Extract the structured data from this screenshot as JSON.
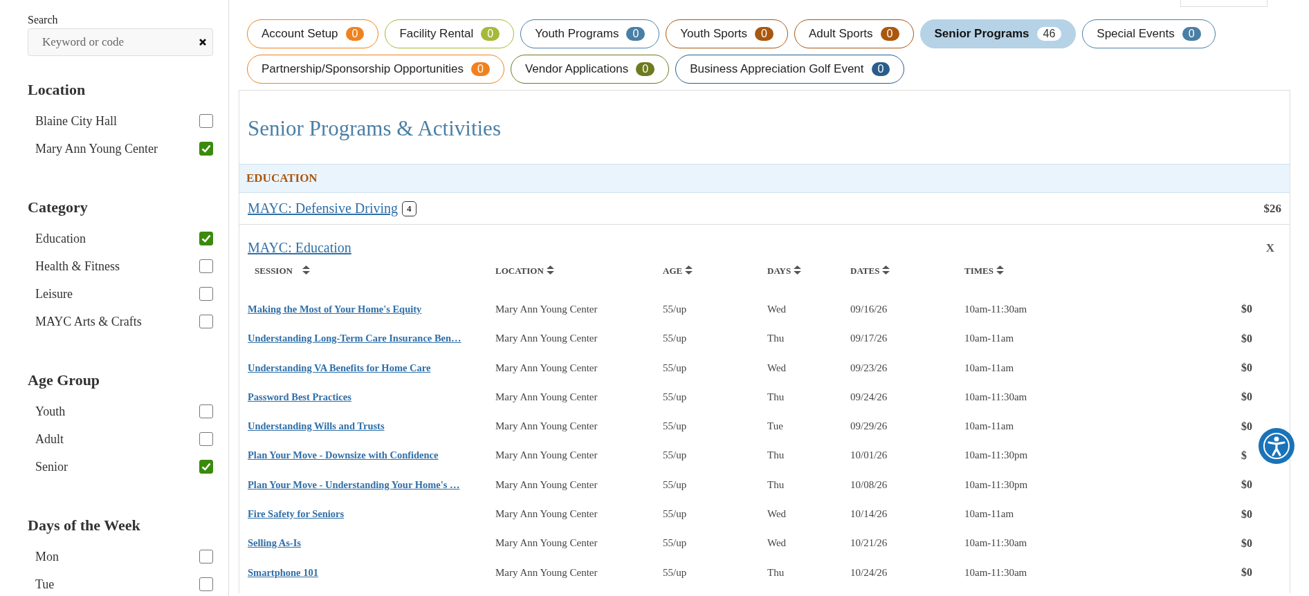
{
  "search": {
    "label": "Search",
    "placeholder": "Keyword or code"
  },
  "filters": [
    {
      "title": "Location",
      "options": [
        {
          "label": "Blaine City Hall",
          "checked": false
        },
        {
          "label": "Mary Ann Young Center",
          "checked": true
        }
      ]
    },
    {
      "title": "Category",
      "options": [
        {
          "label": "Education",
          "checked": true
        },
        {
          "label": "Health & Fitness",
          "checked": false
        },
        {
          "label": "Leisure",
          "checked": false
        },
        {
          "label": "MAYC Arts & Crafts",
          "checked": false
        }
      ]
    },
    {
      "title": "Age Group",
      "options": [
        {
          "label": "Youth",
          "checked": false
        },
        {
          "label": "Adult",
          "checked": false
        },
        {
          "label": "Senior",
          "checked": true
        }
      ]
    },
    {
      "title": "Days of the Week",
      "options": [
        {
          "label": "Mon",
          "checked": false
        },
        {
          "label": "Tue",
          "checked": false
        }
      ]
    }
  ],
  "tabs": [
    {
      "label": "Account Setup",
      "count": "0",
      "color": "#f0821e",
      "selected": false
    },
    {
      "label": "Facility Rental",
      "count": "0",
      "color": "#a6b938",
      "selected": false
    },
    {
      "label": "Youth Programs",
      "count": "0",
      "color": "#4a7fa5",
      "selected": false
    },
    {
      "label": "Youth Sports",
      "count": "0",
      "color": "#a9570f",
      "selected": false
    },
    {
      "label": "Adult Sports",
      "count": "0",
      "color": "#a9570f",
      "selected": false
    },
    {
      "label": "Senior Programs",
      "count": "46",
      "color": "#b6d2e6",
      "selected": true
    },
    {
      "label": "Special Events",
      "count": "0",
      "color": "#4a7fa5",
      "selected": false
    },
    {
      "label": "Partnership/Sponsorship Opportunities",
      "count": "0",
      "color": "#f0821e",
      "selected": false
    },
    {
      "label": "Vendor Applications",
      "count": "0",
      "color": "#6e7a1f",
      "selected": false
    },
    {
      "label": "Business Appreciation Golf Event",
      "count": "0",
      "color": "#2a5d8a",
      "selected": false
    }
  ],
  "panel": {
    "title": "Senior Programs & Activities",
    "sections": [
      {
        "heading": "EDUCATION",
        "programs": [
          {
            "kind": "collapsed",
            "title": "MAYC: Defensive Driving",
            "count": "4",
            "price": "$26"
          },
          {
            "kind": "expanded",
            "title": "MAYC: Education",
            "close": "X",
            "columns": [
              "SESSION",
              "LOCATION",
              "AGE",
              "DAYS",
              "DATES",
              "TIMES"
            ],
            "sessions": [
              {
                "session": "Making the Most of Your Home's Equity",
                "location": "Mary Ann Young Center",
                "age": "55/up",
                "days": "Wed",
                "dates": "09/16/26",
                "times": "10am-11:30am",
                "price": "$0"
              },
              {
                "session": "Understanding Long-Term Care Insurance Ben…",
                "location": "Mary Ann Young Center",
                "age": "55/up",
                "days": "Thu",
                "dates": "09/17/26",
                "times": "10am-11am",
                "price": "$0"
              },
              {
                "session": "Understanding VA Benefits for Home Care",
                "location": "Mary Ann Young Center",
                "age": "55/up",
                "days": "Wed",
                "dates": "09/23/26",
                "times": "10am-11am",
                "price": "$0"
              },
              {
                "session": "Password Best Practices",
                "location": "Mary Ann Young Center",
                "age": "55/up",
                "days": "Thu",
                "dates": "09/24/26",
                "times": "10am-11:30am",
                "price": "$0"
              },
              {
                "session": "Understanding Wills and Trusts",
                "location": "Mary Ann Young Center",
                "age": "55/up",
                "days": "Tue",
                "dates": "09/29/26",
                "times": "10am-11am",
                "price": "$0"
              },
              {
                "session": "Plan Your Move - Downsize with Confidence",
                "location": "Mary Ann Young Center",
                "age": "55/up",
                "days": "Thu",
                "dates": "10/01/26",
                "times": "10am-11:30pm",
                "price": "$"
              },
              {
                "session": "Plan Your Move - Understanding Your Home's …",
                "location": "Mary Ann Young Center",
                "age": "55/up",
                "days": "Thu",
                "dates": "10/08/26",
                "times": "10am-11:30pm",
                "price": "$0"
              },
              {
                "session": "Fire Safety for Seniors",
                "location": "Mary Ann Young Center",
                "age": "55/up",
                "days": "Wed",
                "dates": "10/14/26",
                "times": "10am-11am",
                "price": "$0"
              },
              {
                "session": "Selling As-Is",
                "location": "Mary Ann Young Center",
                "age": "55/up",
                "days": "Wed",
                "dates": "10/21/26",
                "times": "10am-11:30am",
                "price": "$0"
              },
              {
                "session": "Smartphone 101",
                "location": "Mary Ann Young Center",
                "age": "55/up",
                "days": "Thu",
                "dates": "10/24/26",
                "times": "10am-11:30am",
                "price": "$0"
              }
            ]
          }
        ]
      }
    ]
  }
}
